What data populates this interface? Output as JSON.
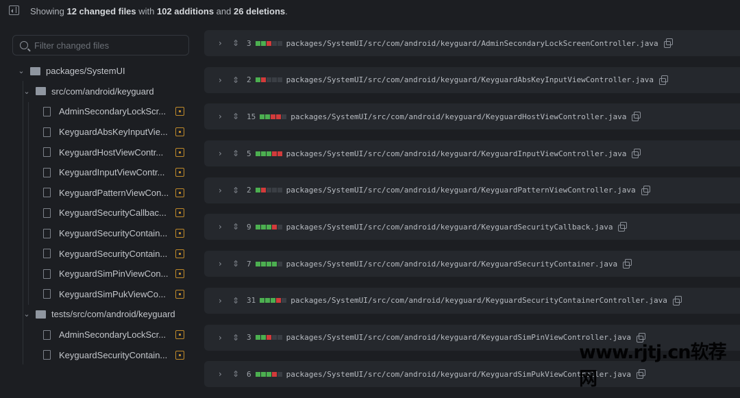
{
  "header": {
    "prefix": "Showing ",
    "files": "12 changed files",
    "mid": " with ",
    "additions": "102 additions",
    "and": " and ",
    "deletions": "26 deletions",
    "suffix": "."
  },
  "search": {
    "placeholder": "Filter changed files"
  },
  "tree": {
    "root": "packages/SystemUI",
    "folders": [
      {
        "name": "src/com/android/keyguard",
        "files": [
          "AdminSecondaryLockScr...",
          "KeyguardAbsKeyInputVie...",
          "KeyguardHostViewContr...",
          "KeyguardInputViewContr...",
          "KeyguardPatternViewCon...",
          "KeyguardSecurityCallbac...",
          "KeyguardSecurityContain...",
          "KeyguardSecurityContain...",
          "KeyguardSimPinViewCon...",
          "KeyguardSimPukViewCo..."
        ]
      },
      {
        "name": "tests/src/com/android/keyguard",
        "files": [
          "AdminSecondaryLockScr...",
          "KeyguardSecurityContain..."
        ]
      }
    ]
  },
  "diffs": [
    {
      "count": "3",
      "bar": "ggrnn",
      "path": "packages/SystemUI/src/com/android/keyguard/AdminSecondaryLockScreenController.java"
    },
    {
      "count": "2",
      "bar": "grnnn",
      "path": "packages/SystemUI/src/com/android/keyguard/KeyguardAbsKeyInputViewController.java"
    },
    {
      "count": "15",
      "bar": "ggrrn",
      "path": "packages/SystemUI/src/com/android/keyguard/KeyguardHostViewController.java"
    },
    {
      "count": "5",
      "bar": "gggrr",
      "path": "packages/SystemUI/src/com/android/keyguard/KeyguardInputViewController.java"
    },
    {
      "count": "2",
      "bar": "grnnn",
      "path": "packages/SystemUI/src/com/android/keyguard/KeyguardPatternViewController.java"
    },
    {
      "count": "9",
      "bar": "gggrn",
      "path": "packages/SystemUI/src/com/android/keyguard/KeyguardSecurityCallback.java"
    },
    {
      "count": "7",
      "bar": "ggggn",
      "path": "packages/SystemUI/src/com/android/keyguard/KeyguardSecurityContainer.java"
    },
    {
      "count": "31",
      "bar": "gggrn",
      "path": "packages/SystemUI/src/com/android/keyguard/KeyguardSecurityContainerController.java"
    },
    {
      "count": "3",
      "bar": "ggrnn",
      "path": "packages/SystemUI/src/com/android/keyguard/KeyguardSimPinViewController.java"
    },
    {
      "count": "6",
      "bar": "gggrn",
      "path": "packages/SystemUI/src/com/android/keyguard/KeyguardSimPukViewController.java"
    }
  ],
  "watermark": "www.rjtj.cn软荐网",
  "colors": {
    "addition": "#4caf50",
    "deletion": "#d23b3b",
    "modified": "#c08a2a"
  }
}
